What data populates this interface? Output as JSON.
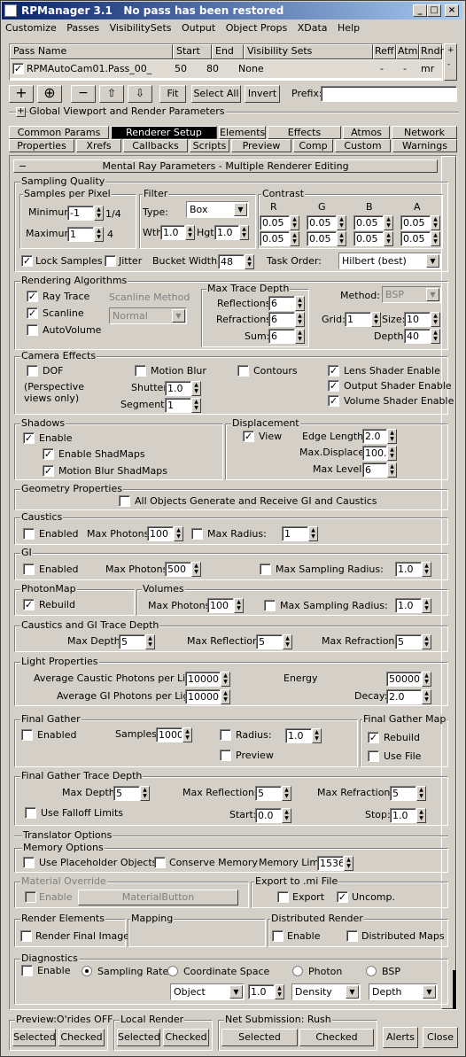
{
  "title": "RPManager 3.1",
  "status": "No pass has been restored",
  "menu": [
    "Customize",
    "Passes",
    "VisibilitySets",
    "Output",
    "Object Props",
    "XData",
    "Help"
  ],
  "passes": {
    "headers": [
      "Pass Name",
      "Start",
      "End",
      "Visibility Sets",
      "Reff",
      "Atm",
      "Rndr"
    ],
    "row": {
      "name": "RPMAutoCam01.Pass_00_",
      "start": "50",
      "end": "80",
      "vis": "None",
      "reff": "-",
      "atm": "-",
      "rndr": "mr"
    }
  },
  "toolbar": {
    "fit": "Fit",
    "select_all": "Select All",
    "invert": "Invert",
    "prefix": "Prefix:"
  },
  "global_viewport": "Global Viewport and Render Parameters",
  "tabs_row1": [
    "Common Params",
    "Renderer Setup",
    "Elements",
    "Effects",
    "Atmos",
    "Network"
  ],
  "tabs_row2": [
    "Properties",
    "Xrefs",
    "Callbacks",
    "Scripts",
    "Preview",
    "Comp",
    "Custom",
    "Warnings"
  ],
  "rollout_title": "Mental Ray Parameters - Multiple Renderer Editing",
  "sampling": {
    "title": "Sampling Quality",
    "spp": "Samples per Pixel",
    "min_label": "Minimum",
    "min_val": "-1",
    "min_ratio": "1/4",
    "max_label": "Maximum",
    "max_val": "1",
    "max_ratio": "4",
    "filter": "Filter",
    "type_label": "Type:",
    "type_val": "Box",
    "wth_label": "Wth",
    "wth_val": "1.0",
    "hgt_label": "Hgt",
    "hgt_val": "1.0",
    "contrast": "Contrast",
    "ch": [
      "R",
      "G",
      "B",
      "A"
    ],
    "cv": [
      "0.05",
      "0.05"
    ],
    "lock": "Lock Samples",
    "jitter": "Jitter",
    "bucket_label": "Bucket Width:",
    "bucket_val": "48",
    "task_label": "Task Order:",
    "task_val": "Hilbert (best)"
  },
  "render_algo": {
    "title": "Rendering Algorithms",
    "raytrace": "Ray Trace",
    "scanline": "Scanline",
    "autovolume": "AutoVolume",
    "scan_method": "Scanline Method",
    "scan_val": "Normal",
    "mtd": "Max Trace Depth",
    "refl_l": "Reflections:",
    "refl_v": "6",
    "refr_l": "Refractions:",
    "refr_v": "6",
    "sum_l": "Sum:",
    "sum_v": "6",
    "method_l": "Method:",
    "method_v": "BSP",
    "grid_l": "Grid:",
    "grid_v": "1",
    "size_l": "Size:",
    "size_v": "10",
    "depth_l": "Depth:",
    "depth_v": "40"
  },
  "camera": {
    "title": "Camera Effects",
    "dof": "DOF",
    "persp": "(Perspective views only)",
    "motion": "Motion Blur",
    "shutter_l": "Shutter",
    "shutter_v": "1.0",
    "seg_l": "Segments",
    "seg_v": "1",
    "contours": "Contours",
    "lens": "Lens Shader Enable",
    "output": "Output Shader Enable",
    "volume": "Volume Shader Enable"
  },
  "shadows": {
    "title": "Shadows",
    "enable": "Enable",
    "shadmaps": "Enable ShadMaps",
    "mbshad": "Motion Blur ShadMaps"
  },
  "displacement": {
    "title": "Displacement",
    "view": "View",
    "edge_l": "Edge Length:",
    "edge_v": "2.0",
    "maxd_l": "Max.Displace:",
    "maxd_v": "100.0",
    "maxl_l": "Max Level:",
    "maxl_v": "6"
  },
  "geometry": {
    "title": "Geometry Properties",
    "all": "All Objects Generate and Receive GI and Caustics"
  },
  "caustics": {
    "title": "Caustics",
    "enabled": "Enabled",
    "mp_l": "Max Photons:",
    "mp_v": "100",
    "mr_l": "Max Radius:",
    "mr_v": "1"
  },
  "gi": {
    "title": "GI",
    "enabled": "Enabled",
    "mp_l": "Max Photons:",
    "mp_v": "500",
    "msr_l": "Max Sampling Radius:",
    "msr_v": "1.0"
  },
  "photonmap": {
    "title": "PhotonMap",
    "rebuild": "Rebuild"
  },
  "volumes": {
    "title": "Volumes",
    "mp_l": "Max Photons:",
    "mp_v": "100",
    "msr_l": "Max Sampling Radius:",
    "msr_v": "1.0"
  },
  "cgitd": {
    "title": "Caustics and GI Trace Depth",
    "md_l": "Max Depth:",
    "md_v": "5",
    "mrefl_l": "Max Reflections:",
    "mrefl_v": "5",
    "mrefr_l": "Max Refractions:",
    "mrefr_v": "5"
  },
  "light": {
    "title": "Light Properties",
    "acp_l": "Average Caustic Photons per Light:",
    "acp_v": "10000",
    "agi_l": "Average GI Photons per Light:",
    "agi_v": "10000",
    "energy_l": "Energy",
    "energy_v": "50000.0",
    "decay_l": "Decay:",
    "decay_v": "2.0"
  },
  "fg": {
    "title": "Final Gather",
    "enabled": "Enabled",
    "samples_l": "Samples:",
    "samples_v": "1000",
    "radius": "Radius:",
    "radius_v": "1.0",
    "preview": "Preview"
  },
  "fgmap": {
    "title": "Final Gather Map",
    "rebuild": "Rebuild",
    "usefile": "Use File"
  },
  "fgtd": {
    "title": "Final Gather Trace Depth",
    "md_l": "Max Depth:",
    "md_v": "5",
    "mrefl_l": "Max Reflections:",
    "mrefl_v": "5",
    "mrefr_l": "Max Refractions:",
    "mrefr_v": "5",
    "falloff": "Use Falloff Limits",
    "start_l": "Start:",
    "start_v": "0.0",
    "stop_l": "Stop:",
    "stop_v": "1.0"
  },
  "translator": {
    "title": "Translator Options"
  },
  "memory": {
    "title": "Memory Options",
    "placeholder": "Use Placeholder Objects",
    "conserve": "Conserve Memory",
    "limit_l": "Memory Limit:",
    "limit_v": "1536"
  },
  "matover": {
    "title": "Material Override",
    "enable": "Enable",
    "btn": "MaterialButton"
  },
  "exportmi": {
    "title": "Export to .mi File",
    "export": "Export",
    "uncomp": "Uncomp."
  },
  "relem": {
    "title": "Render Elements",
    "final": "Render Final Image"
  },
  "mapping": {
    "title": "Mapping"
  },
  "distrib": {
    "title": "Distributed Render",
    "enable": "Enable",
    "maps": "Distributed Maps"
  },
  "diag": {
    "title": "Diagnostics",
    "enable": "Enable",
    "sampling": "Sampling Rate",
    "coord": "Coordinate Space",
    "photon": "Photon",
    "bsp": "BSP",
    "d1": "Object",
    "d2": "1.0",
    "d3": "Density",
    "d4": "Depth"
  },
  "bottom": {
    "preview": "Preview:O'rides OFF",
    "local": "Local Render",
    "net": "Net Submission: Rush",
    "selected": "Selected",
    "checked": "Checked",
    "alerts": "Alerts",
    "close": "Close"
  }
}
